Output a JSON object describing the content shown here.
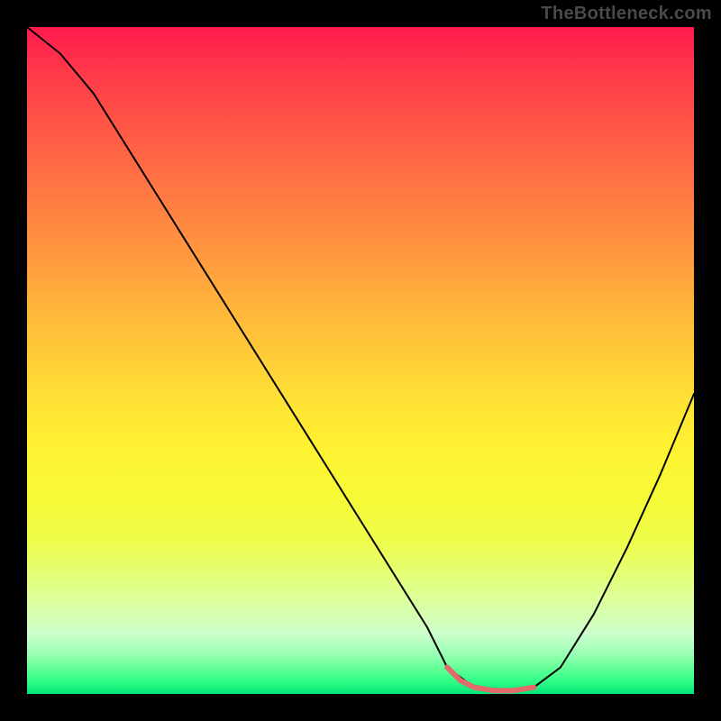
{
  "watermark": "TheBottleneck.com",
  "chart_data": {
    "type": "line",
    "title": "",
    "xlabel": "",
    "ylabel": "",
    "xlim": [
      0,
      100
    ],
    "ylim": [
      0,
      100
    ],
    "grid": false,
    "legend": false,
    "series": [
      {
        "name": "bottleneck-curve",
        "x": [
          0,
          5,
          10,
          15,
          20,
          25,
          30,
          35,
          40,
          45,
          50,
          55,
          60,
          63,
          67,
          70,
          73,
          76,
          80,
          85,
          90,
          95,
          100
        ],
        "values": [
          100,
          96,
          90,
          82,
          74,
          66,
          58,
          50,
          42,
          34,
          26,
          18,
          10,
          4,
          1,
          0.5,
          0.5,
          1,
          4,
          12,
          22,
          33,
          45
        ]
      }
    ],
    "highlight_segment": {
      "name": "valley-highlight",
      "x": [
        63,
        65,
        67,
        70,
        73,
        76
      ],
      "values": [
        4,
        2,
        1,
        0.5,
        0.5,
        1
      ],
      "color": "#e26a6a",
      "width": 6
    }
  },
  "colors": {
    "background": "#000000",
    "curve": "#000000",
    "highlight": "#e26a6a",
    "gradient_top": "#ff1a4d",
    "gradient_bottom": "#00e676"
  }
}
